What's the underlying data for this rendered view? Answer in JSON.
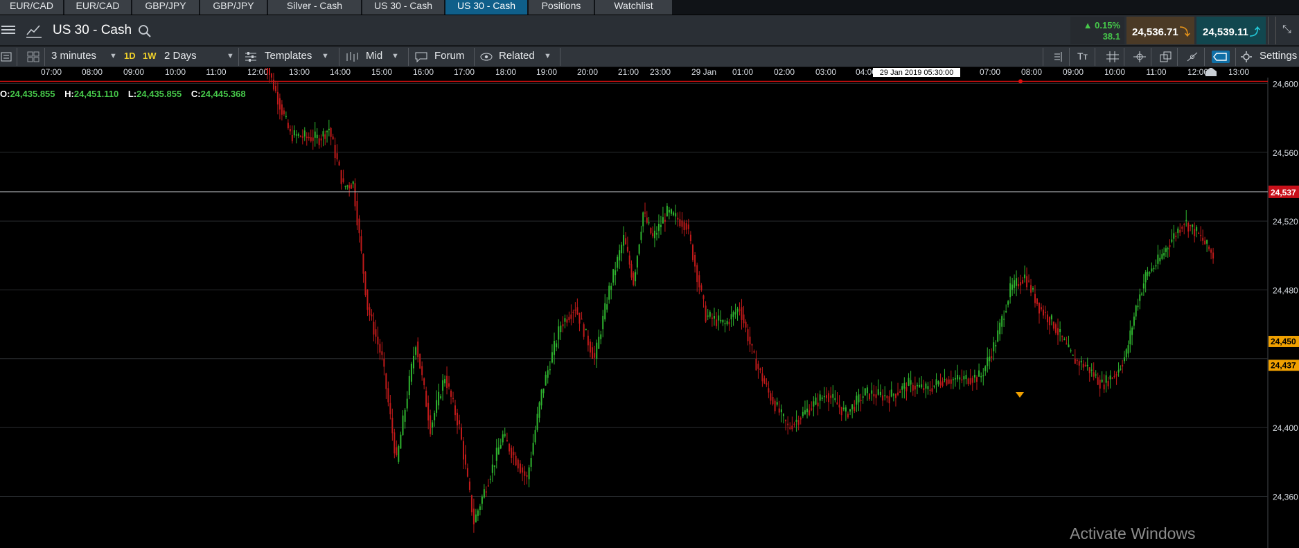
{
  "tabs": [
    {
      "label": "EUR/CAD",
      "active": false
    },
    {
      "label": "EUR/CAD",
      "active": false
    },
    {
      "label": "GBP/JPY",
      "active": false
    },
    {
      "label": "GBP/JPY",
      "active": false
    },
    {
      "label": "Silver - Cash",
      "active": false
    },
    {
      "label": "US 30 - Cash",
      "active": false
    },
    {
      "label": "US 30 - Cash",
      "active": true
    },
    {
      "label": "Positions",
      "active": false
    },
    {
      "label": "Watchlist",
      "active": false
    }
  ],
  "header": {
    "title": "US 30 - Cash",
    "change_pct": "▲ 0.15%",
    "change_pts": "38.1",
    "bid": "24,536.71",
    "ask": "24,539.11"
  },
  "toolbar": {
    "interval": "3 minutes",
    "range_1d": "1D",
    "range_1w": "1W",
    "period": "2 Days",
    "templates": "Templates",
    "price_type": "Mid",
    "forum": "Forum",
    "related": "Related",
    "settings": "Settings"
  },
  "ohlc": {
    "o_label": "O:",
    "o": "24,435.855",
    "h_label": "H:",
    "h": "24,451.110",
    "l_label": "L:",
    "l": "24,435.855",
    "c_label": "C:",
    "c": "24,445.368"
  },
  "crosshair_time": "29 Jan 2019 05:30:00",
  "watermark": "Activate Windows",
  "colors": {
    "up": "#2fb52f",
    "down": "#c01a1a",
    "accent": "#0f5f8a",
    "marker": "#f0a000"
  },
  "chart_data": {
    "type": "candlestick",
    "x_tick_labels": [
      "07:00",
      "08:00",
      "09:00",
      "10:00",
      "11:00",
      "12:00",
      "13:00",
      "14:00",
      "15:00",
      "16:00",
      "17:00",
      "18:00",
      "19:00",
      "20:00",
      "21:00",
      "23:00",
      "29 Jan",
      "01:00",
      "02:00",
      "03:00",
      "04:00",
      "07:00",
      "08:00",
      "09:00",
      "10:00",
      "11:00",
      "12:00",
      "13:00"
    ],
    "y_tick_labels": [
      "24,600",
      "24,560",
      "24,520",
      "24,480",
      "24,360",
      "24,400"
    ],
    "ylim": [
      24330,
      24605
    ],
    "grid": true,
    "current_price": 24537,
    "current_price_label": "24,537",
    "high_line": 24600,
    "marker_labels": [
      "24,450",
      "24,437"
    ],
    "path": [
      [
        0,
        24620
      ],
      [
        30,
        24570
      ],
      [
        60,
        24568
      ],
      [
        70,
        24574
      ],
      [
        85,
        24540
      ],
      [
        95,
        24542
      ],
      [
        110,
        24470
      ],
      [
        125,
        24440
      ],
      [
        140,
        24380
      ],
      [
        160,
        24450
      ],
      [
        175,
        24400
      ],
      [
        190,
        24430
      ],
      [
        205,
        24400
      ],
      [
        220,
        24345
      ],
      [
        250,
        24395
      ],
      [
        275,
        24370
      ],
      [
        290,
        24420
      ],
      [
        310,
        24460
      ],
      [
        325,
        24470
      ],
      [
        345,
        24440
      ],
      [
        360,
        24480
      ],
      [
        375,
        24510
      ],
      [
        385,
        24485
      ],
      [
        395,
        24525
      ],
      [
        405,
        24510
      ],
      [
        420,
        24525
      ],
      [
        440,
        24518
      ],
      [
        460,
        24465
      ],
      [
        480,
        24460
      ],
      [
        495,
        24470
      ],
      [
        510,
        24440
      ],
      [
        525,
        24420
      ],
      [
        545,
        24400
      ],
      [
        565,
        24410
      ],
      [
        585,
        24420
      ],
      [
        605,
        24408
      ],
      [
        625,
        24420
      ],
      [
        650,
        24418
      ],
      [
        670,
        24425
      ],
      [
        690,
        24422
      ],
      [
        705,
        24428
      ],
      [
        725,
        24428
      ],
      [
        745,
        24430
      ],
      [
        760,
        24450
      ],
      [
        775,
        24480
      ],
      [
        790,
        24488
      ],
      [
        805,
        24470
      ],
      [
        820,
        24460
      ],
      [
        840,
        24440
      ],
      [
        855,
        24435
      ],
      [
        870,
        24425
      ],
      [
        885,
        24432
      ],
      [
        895,
        24443
      ],
      [
        905,
        24470
      ],
      [
        915,
        24488
      ],
      [
        930,
        24498
      ],
      [
        940,
        24508
      ],
      [
        955,
        24520
      ],
      [
        970,
        24512
      ],
      [
        985,
        24500
      ],
      [
        1000,
        24495
      ],
      [
        1010,
        24475
      ],
      [
        1020,
        24505
      ],
      [
        1030,
        24540
      ]
    ]
  }
}
